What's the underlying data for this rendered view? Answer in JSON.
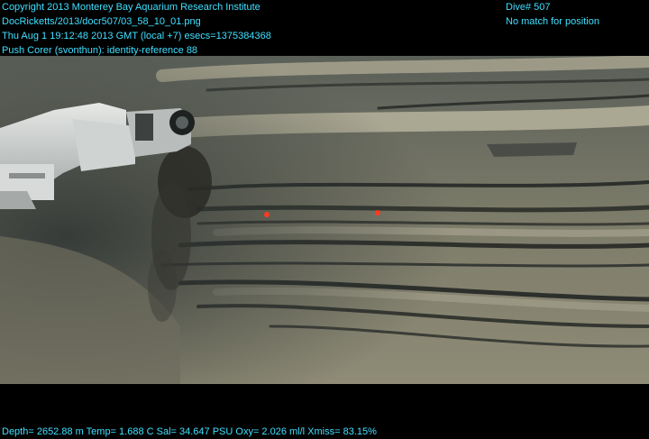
{
  "header": {
    "line1": "Copyright 2013 Monterey Bay Aquarium Research Institute",
    "line2": "DocRicketts/2013/docr507/03_58_10_01.png",
    "line3": "Thu Aug  1 19:12:48 2013 GMT (local +7)  esecs=1375384368",
    "line4": "Push Corer (svonthun): identity-reference 88"
  },
  "header_right": {
    "line1": "Dive# 507",
    "line2": "No match for position"
  },
  "footer": {
    "sensors": "Depth= 2652.88 m  Temp= 1.688 C  Sal= 34.647 PSU  Oxy= 2.026 ml/l  Xmiss= 83.15%"
  },
  "colors": {
    "overlay_text": "#3fe0ff",
    "background": "#000000",
    "seafloor": "#8a8a78",
    "water": "#4e5653"
  },
  "image": {
    "subject": "ROV manipulator arm taking a push core sample from layered seafloor sediment"
  }
}
